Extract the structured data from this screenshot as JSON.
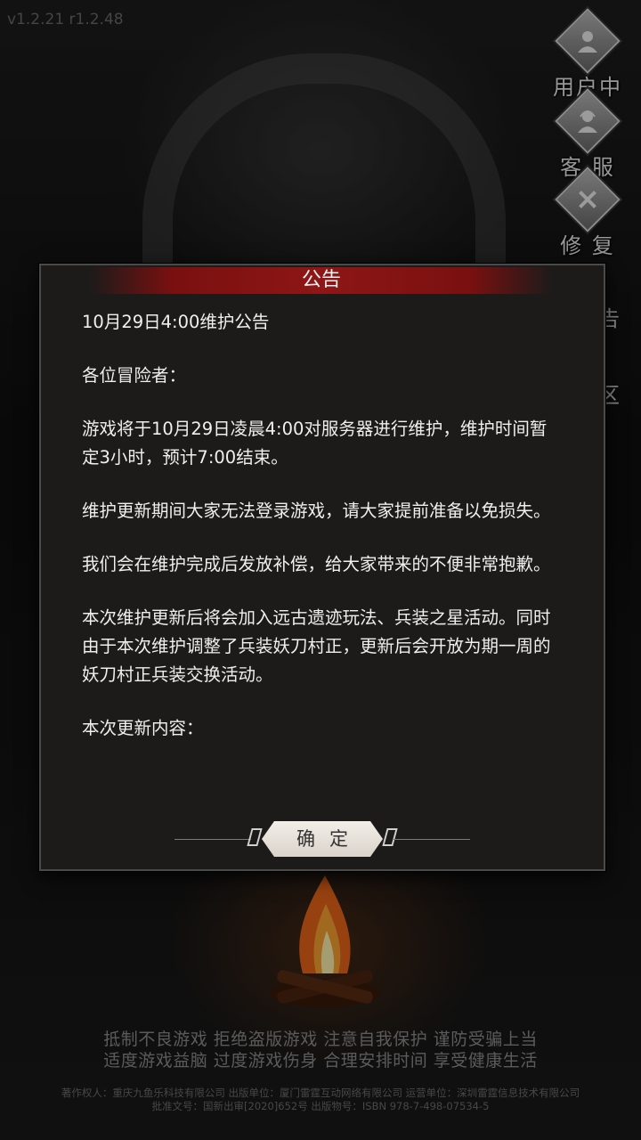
{
  "version": "v1.2.21 r1.2.48",
  "side_menu": [
    {
      "label": "用户中心",
      "icon": "user-icon"
    },
    {
      "label": "客 服",
      "icon": "support-icon"
    },
    {
      "label": "修 复",
      "icon": "repair-icon"
    }
  ],
  "side_partial": [
    "告",
    "区"
  ],
  "dialog": {
    "title": "公告",
    "paragraphs": [
      "10月29日4:00维护公告",
      "各位冒险者：",
      "游戏将于10月29日凌晨4:00对服务器进行维护，维护时间暂定3小时，预计7:00结束。",
      "维护更新期间大家无法登录游戏，请大家提前准备以免损失。",
      "我们会在维护完成后发放补偿，给大家带来的不便非常抱歉。",
      "本次维护更新后将会加入远古遗迹玩法、兵装之星活动。同时由于本次维护调整了兵装妖刀村正，更新后会开放为期一周的妖刀村正兵装交换活动。",
      "本次更新内容："
    ],
    "confirm_label": "确定"
  },
  "footer": {
    "slogan_line1": "抵制不良游戏 拒绝盗版游戏 注意自我保护 谨防受骗上当",
    "slogan_line2": "适度游戏益脑 过度游戏伤身 合理安排时间 享受健康生活",
    "credit_line1": "著作权人：重庆九鱼乐科技有限公司 出版单位：厦门雷霆互动网络有限公司 运营单位：深圳雷霆信息技术有限公司",
    "credit_line2": "批准文号：国新出审[2020]652号 出版物号：ISBN 978-7-498-07534-5"
  },
  "colors": {
    "title_bar": "#8e1616",
    "dialog_bg": "#1c1b1a",
    "confirm_bg": "#ece6de"
  }
}
